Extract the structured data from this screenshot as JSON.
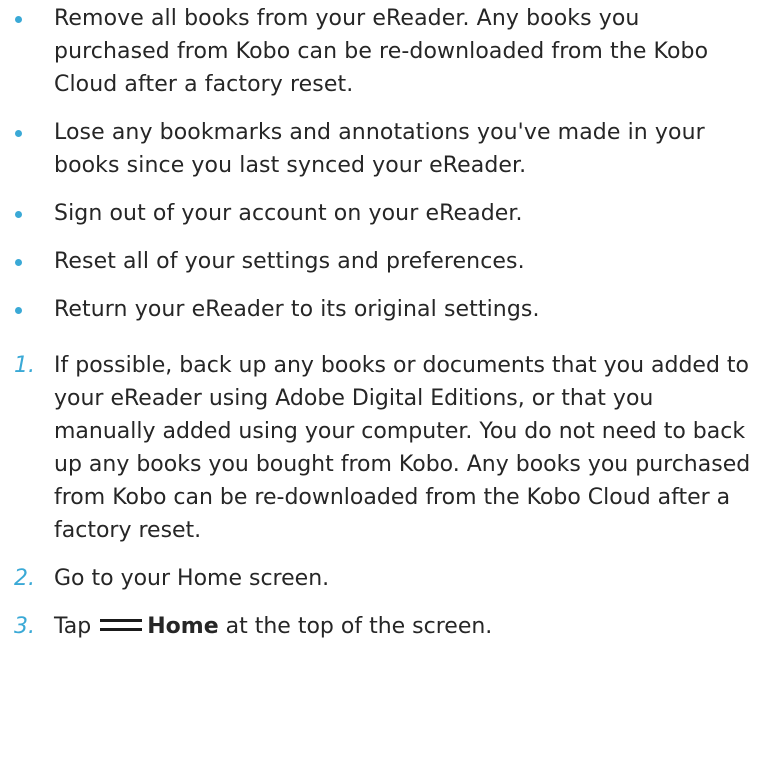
{
  "colors": {
    "accent": "#3aa9d6",
    "text": "#262626"
  },
  "bullets": [
    "Remove all books from your eReader. Any books you purchased from Kobo can be re-downloaded from the Kobo Cloud after a factory reset.",
    "Lose any bookmarks and annotations you've made in your books since you last synced your eReader.",
    "Sign out of your account on your eReader.",
    "Reset all of your settings and preferences.",
    "Return your eReader to its original settings."
  ],
  "steps": [
    {
      "number": "1.",
      "text": "If possible, back up any books or documents that you added to your eReader using Adobe Digital Editions, or that you manually added using your computer. You do not need to back up any books you bought from Kobo. Any books you purchased from Kobo can be re-downloaded from the Kobo Cloud after a factory reset."
    },
    {
      "number": "2.",
      "text": "Go to your Home screen."
    },
    {
      "number": "3.",
      "prefix": "Tap",
      "icon": "menu-icon",
      "bold": "Home",
      "suffix": "at the top of the screen."
    }
  ]
}
